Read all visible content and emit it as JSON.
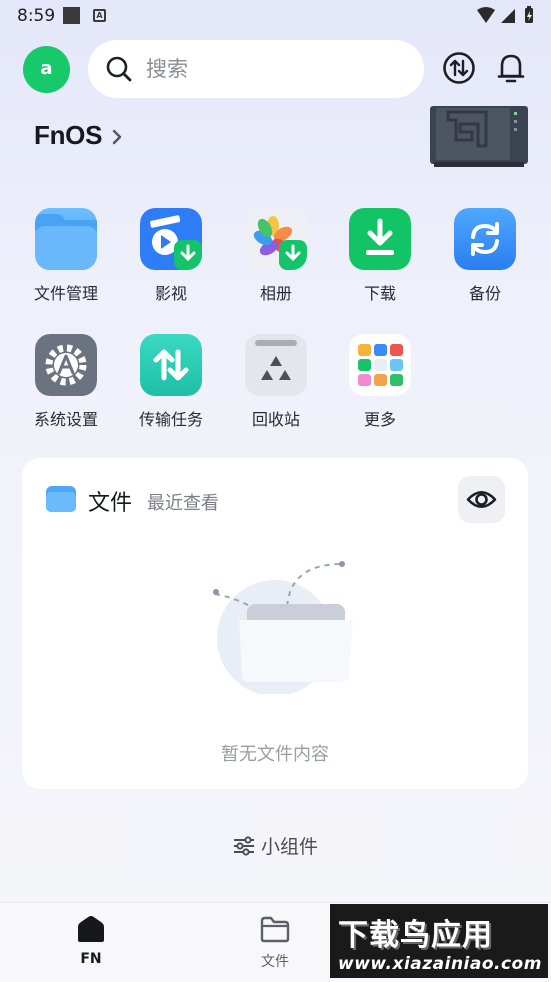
{
  "status_bar": {
    "time": "8:59",
    "notification_badge": "A"
  },
  "header": {
    "avatar_letter": "a",
    "search_placeholder": "搜索",
    "transfer_icon": "transfer-icon",
    "bell_icon": "bell-icon"
  },
  "device": {
    "name": "FnOS"
  },
  "apps": [
    {
      "label": "文件管理",
      "icon": "folder-icon",
      "color": "#4ea6f5"
    },
    {
      "label": "影视",
      "icon": "movie-icon",
      "color": "#2e7cf6"
    },
    {
      "label": "相册",
      "icon": "photos-icon",
      "color": "#f4b63a"
    },
    {
      "label": "下载",
      "icon": "download-icon",
      "color": "#12c466"
    },
    {
      "label": "备份",
      "icon": "backup-icon",
      "color": "#2f8cf5"
    },
    {
      "label": "系统设置",
      "icon": "settings-icon",
      "color": "#6b7280"
    },
    {
      "label": "传输任务",
      "icon": "transfer-task-icon",
      "color": "#2fd0b4"
    },
    {
      "label": "回收站",
      "icon": "recycle-bin-icon",
      "color": "#e3e7ec"
    },
    {
      "label": "更多",
      "icon": "more-apps-icon",
      "color": "#ffffff"
    }
  ],
  "files_card": {
    "title": "文件",
    "subtitle": "最近查看",
    "empty_text": "暂无文件内容"
  },
  "widgets_label": "小组件",
  "bottom_nav": [
    {
      "label": "FN",
      "icon": "home-icon",
      "active": true
    },
    {
      "label": "文件",
      "icon": "folder-outline-icon",
      "active": false
    }
  ],
  "watermark": {
    "title": "下载鸟应用",
    "url": "www.xiazainiao.com"
  }
}
